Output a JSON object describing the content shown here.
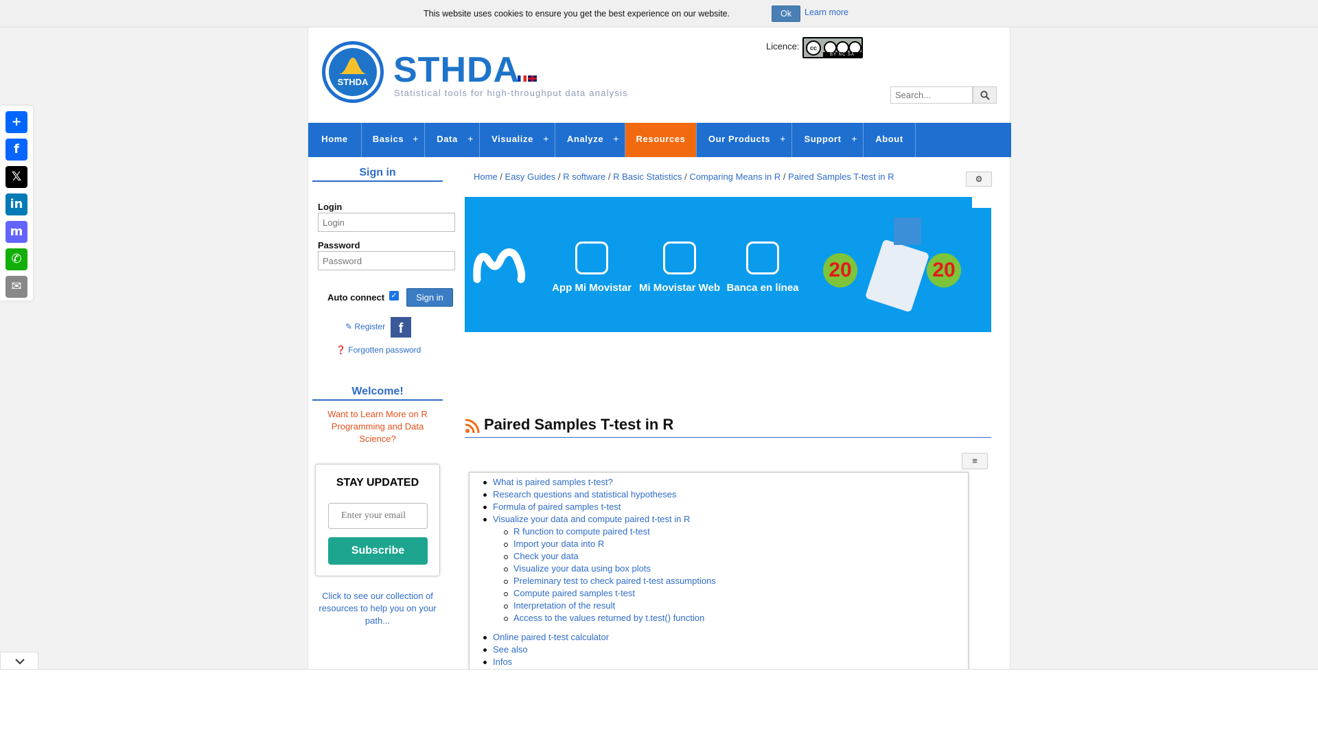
{
  "cookie": {
    "message": "This website uses cookies to ensure you get the best experience on our website.",
    "ok_label": "Ok",
    "learn_more": "Learn more"
  },
  "share": {
    "items": [
      {
        "name": "share",
        "glyph": "+",
        "color": "#0166ff"
      },
      {
        "name": "facebook",
        "glyph": "f",
        "color": "#0866ff"
      },
      {
        "name": "x",
        "glyph": "𝕏",
        "color": "#000000"
      },
      {
        "name": "linkedin",
        "glyph": "in",
        "color": "#007bb5"
      },
      {
        "name": "mastodon",
        "glyph": "m",
        "color": "#6364ff"
      },
      {
        "name": "whatsapp",
        "glyph": "✆",
        "color": "#12af0a"
      },
      {
        "name": "email",
        "glyph": "✉",
        "color": "#888888"
      }
    ]
  },
  "header": {
    "logo_text": "STHDA",
    "title": "STHDA",
    "subtitle": "Statistical tools for high-throughput data analysis",
    "licence_label": "Licence:",
    "licence_badge": {
      "main": "cc",
      "strip": "BY NC SA"
    },
    "search_placeholder": "Search..."
  },
  "nav": {
    "items": [
      {
        "label": "Home",
        "plus": false
      },
      {
        "label": "Basics",
        "plus": true
      },
      {
        "label": "Data",
        "plus": true
      },
      {
        "label": "Visualize",
        "plus": true
      },
      {
        "label": "Analyze",
        "plus": true
      },
      {
        "label": "Resources",
        "plus": false,
        "active": true
      },
      {
        "label": "Our Products",
        "plus": true
      },
      {
        "label": "Support",
        "plus": true
      },
      {
        "label": "About",
        "plus": false
      }
    ],
    "plus_glyph": "+"
  },
  "sidebar": {
    "signin_heading": "Sign in",
    "login_label": "Login",
    "login_placeholder": "Login",
    "password_label": "Password",
    "password_placeholder": "Password",
    "auto_connect": "Auto connect",
    "signin_button": "Sign in",
    "register": "Register",
    "forgotten": "Forgotten password",
    "welcome_heading": "Welcome!",
    "welcome_text": "Want to Learn More on R Programming and Data Science?",
    "stay_title": "STAY UPDATED",
    "stay_placeholder": "Enter your email",
    "subscribe": "Subscribe",
    "resources_text": "Click to see our collection of resources to help you on your path..."
  },
  "breadcrumb": [
    "Home",
    "Easy Guides",
    "R software",
    "R Basic Statistics",
    "Comparing Means in R",
    "Paired Samples T-test in R"
  ],
  "ad": {
    "items": [
      "App Mi Movistar",
      "Mi Movistar Web",
      "Banca en línea"
    ],
    "badge": "20",
    "brand_color": "#0a9bec"
  },
  "article": {
    "title": "Paired Samples T-test in R"
  },
  "toc": {
    "items": [
      {
        "text": "What is paired samples t-test?",
        "level": 1
      },
      {
        "text": "Research questions and statistical hypotheses",
        "level": 1
      },
      {
        "text": "Formula of paired samples t-test",
        "level": 1
      },
      {
        "text": "Visualize your data and compute paired t-test in R",
        "level": 1
      },
      {
        "text": "R function to compute paired t-test",
        "level": 2
      },
      {
        "text": "Import your data into R",
        "level": 2
      },
      {
        "text": "Check your data",
        "level": 2
      },
      {
        "text": "Visualize your data using box plots",
        "level": 2
      },
      {
        "text": "Preleminary test to check paired t-test assumptions",
        "level": 2
      },
      {
        "text": "Compute paired samples t-test",
        "level": 2
      },
      {
        "text": "Interpretation of the result",
        "level": 2
      },
      {
        "text": "Access to the values returned by t.test() function",
        "level": 2
      },
      {
        "text": "Online paired t-test calculator",
        "level": 1
      },
      {
        "text": "See also",
        "level": 1
      },
      {
        "text": "Infos",
        "level": 1
      }
    ]
  }
}
